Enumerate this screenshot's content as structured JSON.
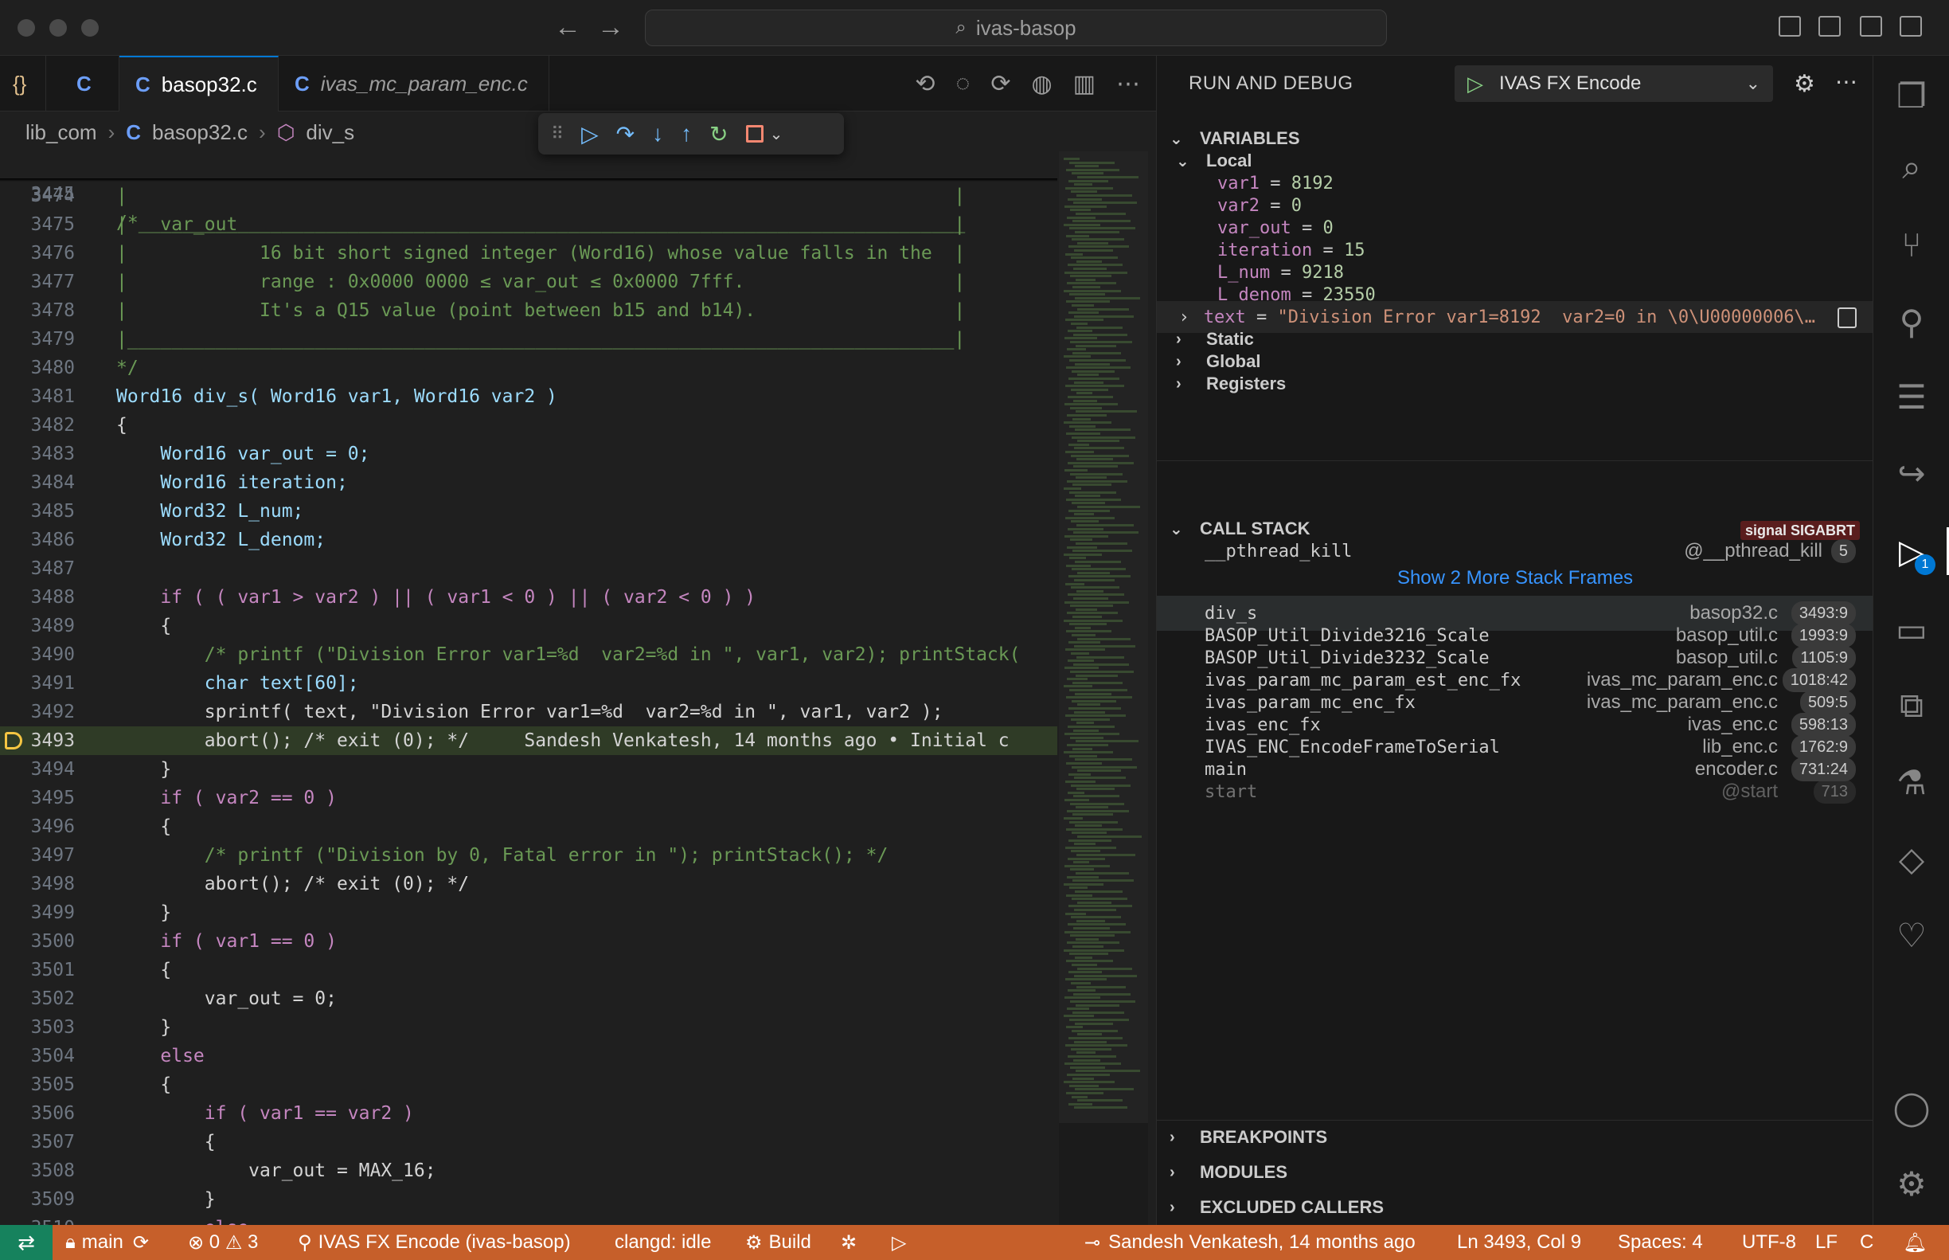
{
  "window": {
    "search_text": "ivas-basop"
  },
  "editor": {
    "tabs": [
      {
        "icon": "{}",
        "label": ""
      },
      {
        "icon": "C",
        "label": ""
      },
      {
        "icon": "C",
        "label": "basop32.c"
      },
      {
        "icon": "C",
        "label": "ivas_mc_param_enc.c"
      }
    ],
    "breadcrumb": {
      "folder": "lib_com",
      "file": "basop32.c",
      "symbol": "div_s"
    },
    "sticky_line": {
      "num": "3445",
      "text": "/*___________________________________________________________________________"
    },
    "lines": [
      {
        "num": "3474",
        "text": "|                                                                           |"
      },
      {
        "num": "3475",
        "text": "|   var_out                                                                 |"
      },
      {
        "num": "3476",
        "text": "|            16 bit short signed integer (Word16) whose value falls in the  |"
      },
      {
        "num": "3477",
        "text": "|            range : 0x0000 0000 ≤ var_out ≤ 0x0000 7fff.                   |"
      },
      {
        "num": "3478",
        "text": "|            It's a Q15 value (point between b15 and b14).                  |"
      },
      {
        "num": "3479",
        "text": "|___________________________________________________________________________|"
      },
      {
        "num": "3480",
        "text": "*/"
      },
      {
        "num": "3481",
        "text": "Word16 div_s( Word16 var1, Word16 var2 )"
      },
      {
        "num": "3482",
        "text": "{"
      },
      {
        "num": "3483",
        "text": "    Word16 var_out = 0;"
      },
      {
        "num": "3484",
        "text": "    Word16 iteration;"
      },
      {
        "num": "3485",
        "text": "    Word32 L_num;"
      },
      {
        "num": "3486",
        "text": "    Word32 L_denom;"
      },
      {
        "num": "3487",
        "text": ""
      },
      {
        "num": "3488",
        "text": "    if ( ( var1 > var2 ) || ( var1 < 0 ) || ( var2 < 0 ) )"
      },
      {
        "num": "3489",
        "text": "    {"
      },
      {
        "num": "3490",
        "text": "        /* printf (\"Division Error var1=%d  var2=%d in \", var1, var2); printStack("
      },
      {
        "num": "3491",
        "text": "        char text[60];"
      },
      {
        "num": "3492",
        "text": "        sprintf( text, \"Division Error var1=%d  var2=%d in \", var1, var2 );"
      },
      {
        "num": "3493",
        "text": "        abort(); /* exit (0); */     Sandesh Venkatesh, 14 months ago • Initial c"
      },
      {
        "num": "3494",
        "text": "    }"
      },
      {
        "num": "3495",
        "text": "    if ( var2 == 0 )"
      },
      {
        "num": "3496",
        "text": "    {"
      },
      {
        "num": "3497",
        "text": "        /* printf (\"Division by 0, Fatal error in \"); printStack(); */"
      },
      {
        "num": "3498",
        "text": "        abort(); /* exit (0); */"
      },
      {
        "num": "3499",
        "text": "    }"
      },
      {
        "num": "3500",
        "text": "    if ( var1 == 0 )"
      },
      {
        "num": "3501",
        "text": "    {"
      },
      {
        "num": "3502",
        "text": "        var_out = 0;"
      },
      {
        "num": "3503",
        "text": "    }"
      },
      {
        "num": "3504",
        "text": "    else"
      },
      {
        "num": "3505",
        "text": "    {"
      },
      {
        "num": "3506",
        "text": "        if ( var1 == var2 )"
      },
      {
        "num": "3507",
        "text": "        {"
      },
      {
        "num": "3508",
        "text": "            var_out = MAX_16;"
      },
      {
        "num": "3509",
        "text": "        }"
      },
      {
        "num": "3510",
        "text": "        else"
      }
    ],
    "current_line": "3493"
  },
  "debug": {
    "header": "RUN AND DEBUG",
    "launch_config": "IVAS FX Encode",
    "variables": {
      "title": "VARIABLES",
      "local_label": "Local",
      "locals": [
        {
          "name": "var1",
          "value": "8192"
        },
        {
          "name": "var2",
          "value": "0"
        },
        {
          "name": "var_out",
          "value": "0"
        },
        {
          "name": "iteration",
          "value": "15"
        },
        {
          "name": "L_num",
          "value": "9218"
        },
        {
          "name": "L_denom",
          "value": "23550"
        }
      ],
      "text_var": {
        "name": "text",
        "value": "\"Division Error var1=8192  var2=0 in \\0\\U00000006\\…"
      },
      "groups": [
        "Static",
        "Global",
        "Registers"
      ]
    },
    "call_stack": {
      "title": "CALL STACK",
      "badge": "signal SIGABRT",
      "top_frame": {
        "name": "__pthread_kill",
        "file": "@__pthread_kill",
        "line": "5"
      },
      "show_more": "Show 2 More Stack Frames",
      "frames": [
        {
          "name": "div_s",
          "file": "basop32.c",
          "line": "3493:9"
        },
        {
          "name": "BASOP_Util_Divide3216_Scale",
          "file": "basop_util.c",
          "line": "1993:9"
        },
        {
          "name": "BASOP_Util_Divide3232_Scale",
          "file": "basop_util.c",
          "line": "1105:9"
        },
        {
          "name": "ivas_param_mc_param_est_enc_fx",
          "file": "ivas_mc_param_enc.c",
          "line": "1018:42"
        },
        {
          "name": "ivas_param_mc_enc_fx",
          "file": "ivas_mc_param_enc.c",
          "line": "509:5"
        },
        {
          "name": "ivas_enc_fx",
          "file": "ivas_enc.c",
          "line": "598:13"
        },
        {
          "name": "IVAS_ENC_EncodeFrameToSerial",
          "file": "lib_enc.c",
          "line": "1762:9"
        },
        {
          "name": "main",
          "file": "encoder.c",
          "line": "731:24"
        },
        {
          "name": "start",
          "file": "@start",
          "line": "713"
        }
      ]
    },
    "breakpoints": "BREAKPOINTS",
    "modules": "MODULES",
    "excluded_callers": "EXCLUDED CALLERS"
  },
  "activity_badge": "1",
  "status": {
    "branch": "main",
    "errors": "0",
    "warnings": "3",
    "debug_session": "IVAS FX Encode (ivas-basop)",
    "clangd": "clangd: idle",
    "build": "Build",
    "blame": "Sandesh Venkatesh, 14 months ago",
    "cursor": "Ln 3493, Col 9",
    "spaces": "Spaces: 4",
    "encoding": "UTF-8",
    "eol": "LF",
    "language": "C"
  },
  "colors": {
    "status_bar": "#c65f2a",
    "current_line": "#2f3b26",
    "accent": "#0078d4"
  }
}
